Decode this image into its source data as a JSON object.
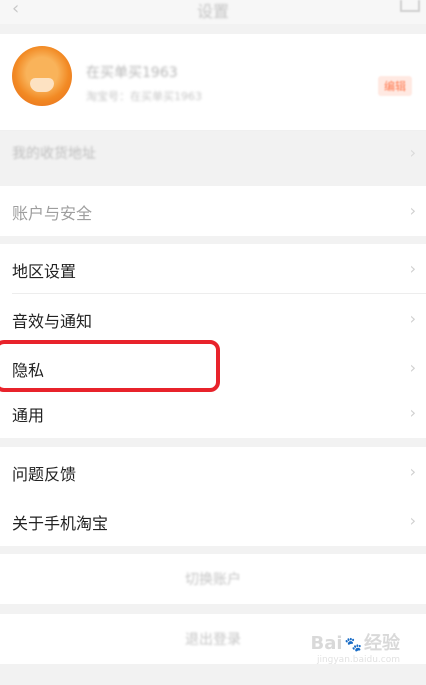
{
  "header": {
    "back_icon": "‹",
    "title": "设置",
    "more_icon": "more-icon"
  },
  "profile": {
    "nickname": "在买单买1963",
    "subtitle": "淘宝号：在买单买1963",
    "badge": "编辑"
  },
  "faded_row": {
    "label": "我的收货地址"
  },
  "rows": [
    {
      "label": "账户与安全"
    },
    {
      "label": "地区设置"
    },
    {
      "label": "音效与通知"
    },
    {
      "label": "隐私"
    },
    {
      "label": "通用"
    },
    {
      "label": "问题反馈"
    },
    {
      "label": "关于手机淘宝"
    }
  ],
  "buttons": {
    "switch_account": "切换账户",
    "logout": "退出登录"
  },
  "chevron": "›",
  "watermark": {
    "brand": "Bai",
    "paw": "🐾",
    "brand2": "经验",
    "url": "jingyan.baidu.com"
  },
  "colors": {
    "highlight": "#e8232b",
    "background": "#f2f2f2"
  }
}
